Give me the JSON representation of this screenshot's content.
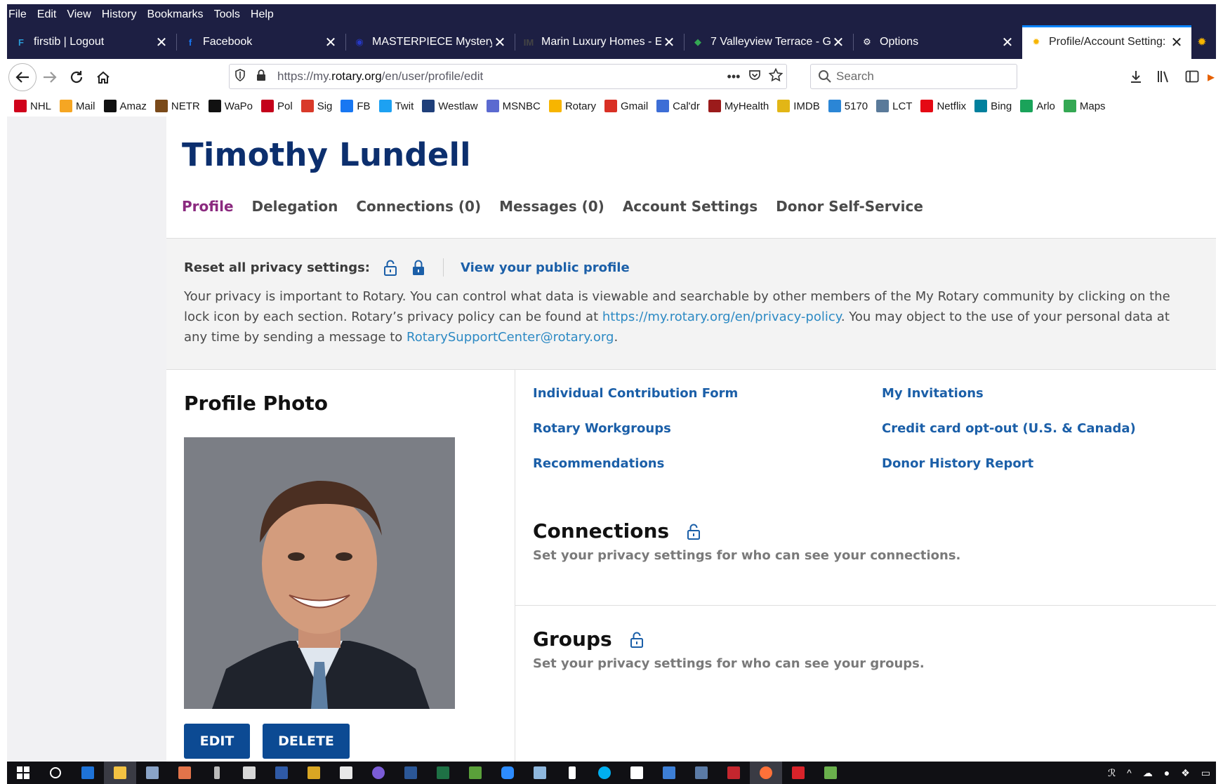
{
  "menu": [
    "File",
    "Edit",
    "View",
    "History",
    "Bookmarks",
    "Tools",
    "Help"
  ],
  "tabs": [
    {
      "label": "firstib | Logout",
      "icon": "f-icon",
      "color": "#2a9ad6",
      "glyph": "F"
    },
    {
      "label": "Facebook",
      "icon": "facebook-icon",
      "color": "#1877f2",
      "glyph": "f"
    },
    {
      "label": "MASTERPIECE Mystery: \\",
      "icon": "pbs-icon",
      "color": "#2638c4",
      "glyph": "◉"
    },
    {
      "label": "Marin Luxury Homes - E",
      "icon": "im-icon",
      "color": "#444444",
      "glyph": "IM"
    },
    {
      "label": "7 Valleyview Terrace - G",
      "icon": "maps-icon",
      "color": "#34a853",
      "glyph": "◆"
    },
    {
      "label": "Options",
      "icon": "gear-icon",
      "color": "#ffffff",
      "glyph": "⚙"
    },
    {
      "label": "Profile/Account Setting:",
      "icon": "rotary-icon",
      "color": "#f7b500",
      "glyph": "✹",
      "active": true
    }
  ],
  "address": {
    "prefix": "https://my.",
    "host": "rotary.org",
    "path": "/en/user/profile/edit"
  },
  "search_placeholder": "Search",
  "bookmarks": [
    {
      "label": "NHL",
      "color": "#d0021b"
    },
    {
      "label": "Mail",
      "color": "#f5a623"
    },
    {
      "label": "Amaz",
      "color": "#111111"
    },
    {
      "label": "NETR",
      "color": "#7a4a1a"
    },
    {
      "label": "WaPo",
      "color": "#111111"
    },
    {
      "label": "Pol",
      "color": "#c4001a"
    },
    {
      "label": "Sig",
      "color": "#d93a2a"
    },
    {
      "label": "FB",
      "color": "#1877f2"
    },
    {
      "label": "Twit",
      "color": "#1da1f2"
    },
    {
      "label": "Westlaw",
      "color": "#1f3f7a"
    },
    {
      "label": "MSNBC",
      "color": "#5b6ad0"
    },
    {
      "label": "Rotary",
      "color": "#f7b500"
    },
    {
      "label": "Gmail",
      "color": "#d93025"
    },
    {
      "label": "Cal'dr",
      "color": "#3d6ed6"
    },
    {
      "label": "MyHealth",
      "color": "#9b1b1b"
    },
    {
      "label": "IMDB",
      "color": "#e2b616"
    },
    {
      "label": "5170",
      "color": "#2b86d6"
    },
    {
      "label": "LCT",
      "color": "#5a7a9a"
    },
    {
      "label": "Netflix",
      "color": "#e50914"
    },
    {
      "label": "Bing",
      "color": "#00809d"
    },
    {
      "label": "Arlo",
      "color": "#1aa35a"
    },
    {
      "label": "Maps",
      "color": "#34a853"
    }
  ],
  "profile": {
    "name": "Timothy Lundell",
    "nav": [
      "Profile",
      "Delegation",
      "Connections (0)",
      "Messages (0)",
      "Account Settings",
      "Donor Self-Service"
    ],
    "privacy": {
      "reset_label": "Reset all privacy settings:",
      "public_profile_link": "View your public profile",
      "text_1": "Your privacy is important to Rotary. You can control what data is viewable and searchable by other members of the My Rotary community by clicking on the lock icon by each section. Rotary’s privacy policy can be found at ",
      "policy_link": "https://my.rotary.org/en/privacy-policy",
      "text_2": ". You may object to the use of your personal data at any time by sending a message to ",
      "email_link": "RotarySupportCenter@rotary.org",
      "text_3": "."
    },
    "photo_heading": "Profile Photo",
    "edit_button": "EDIT",
    "delete_button": "DELETE",
    "links_left": [
      "Individual Contribution Form",
      "Rotary Workgroups",
      "Recommendations"
    ],
    "links_right": [
      "My Invitations",
      "Credit card opt-out (U.S. & Canada)",
      "Donor History Report"
    ],
    "connections": {
      "title": "Connections",
      "desc": "Set your privacy settings for who can see your connections."
    },
    "groups": {
      "title": "Groups",
      "desc": "Set your privacy settings for who can see your groups."
    }
  },
  "colors": {
    "titlebar": "#1d1f43",
    "heading": "#0c2f6e",
    "active_nav": "#8b2a7f",
    "link": "#1b5fa8",
    "button": "#0c4a93"
  }
}
